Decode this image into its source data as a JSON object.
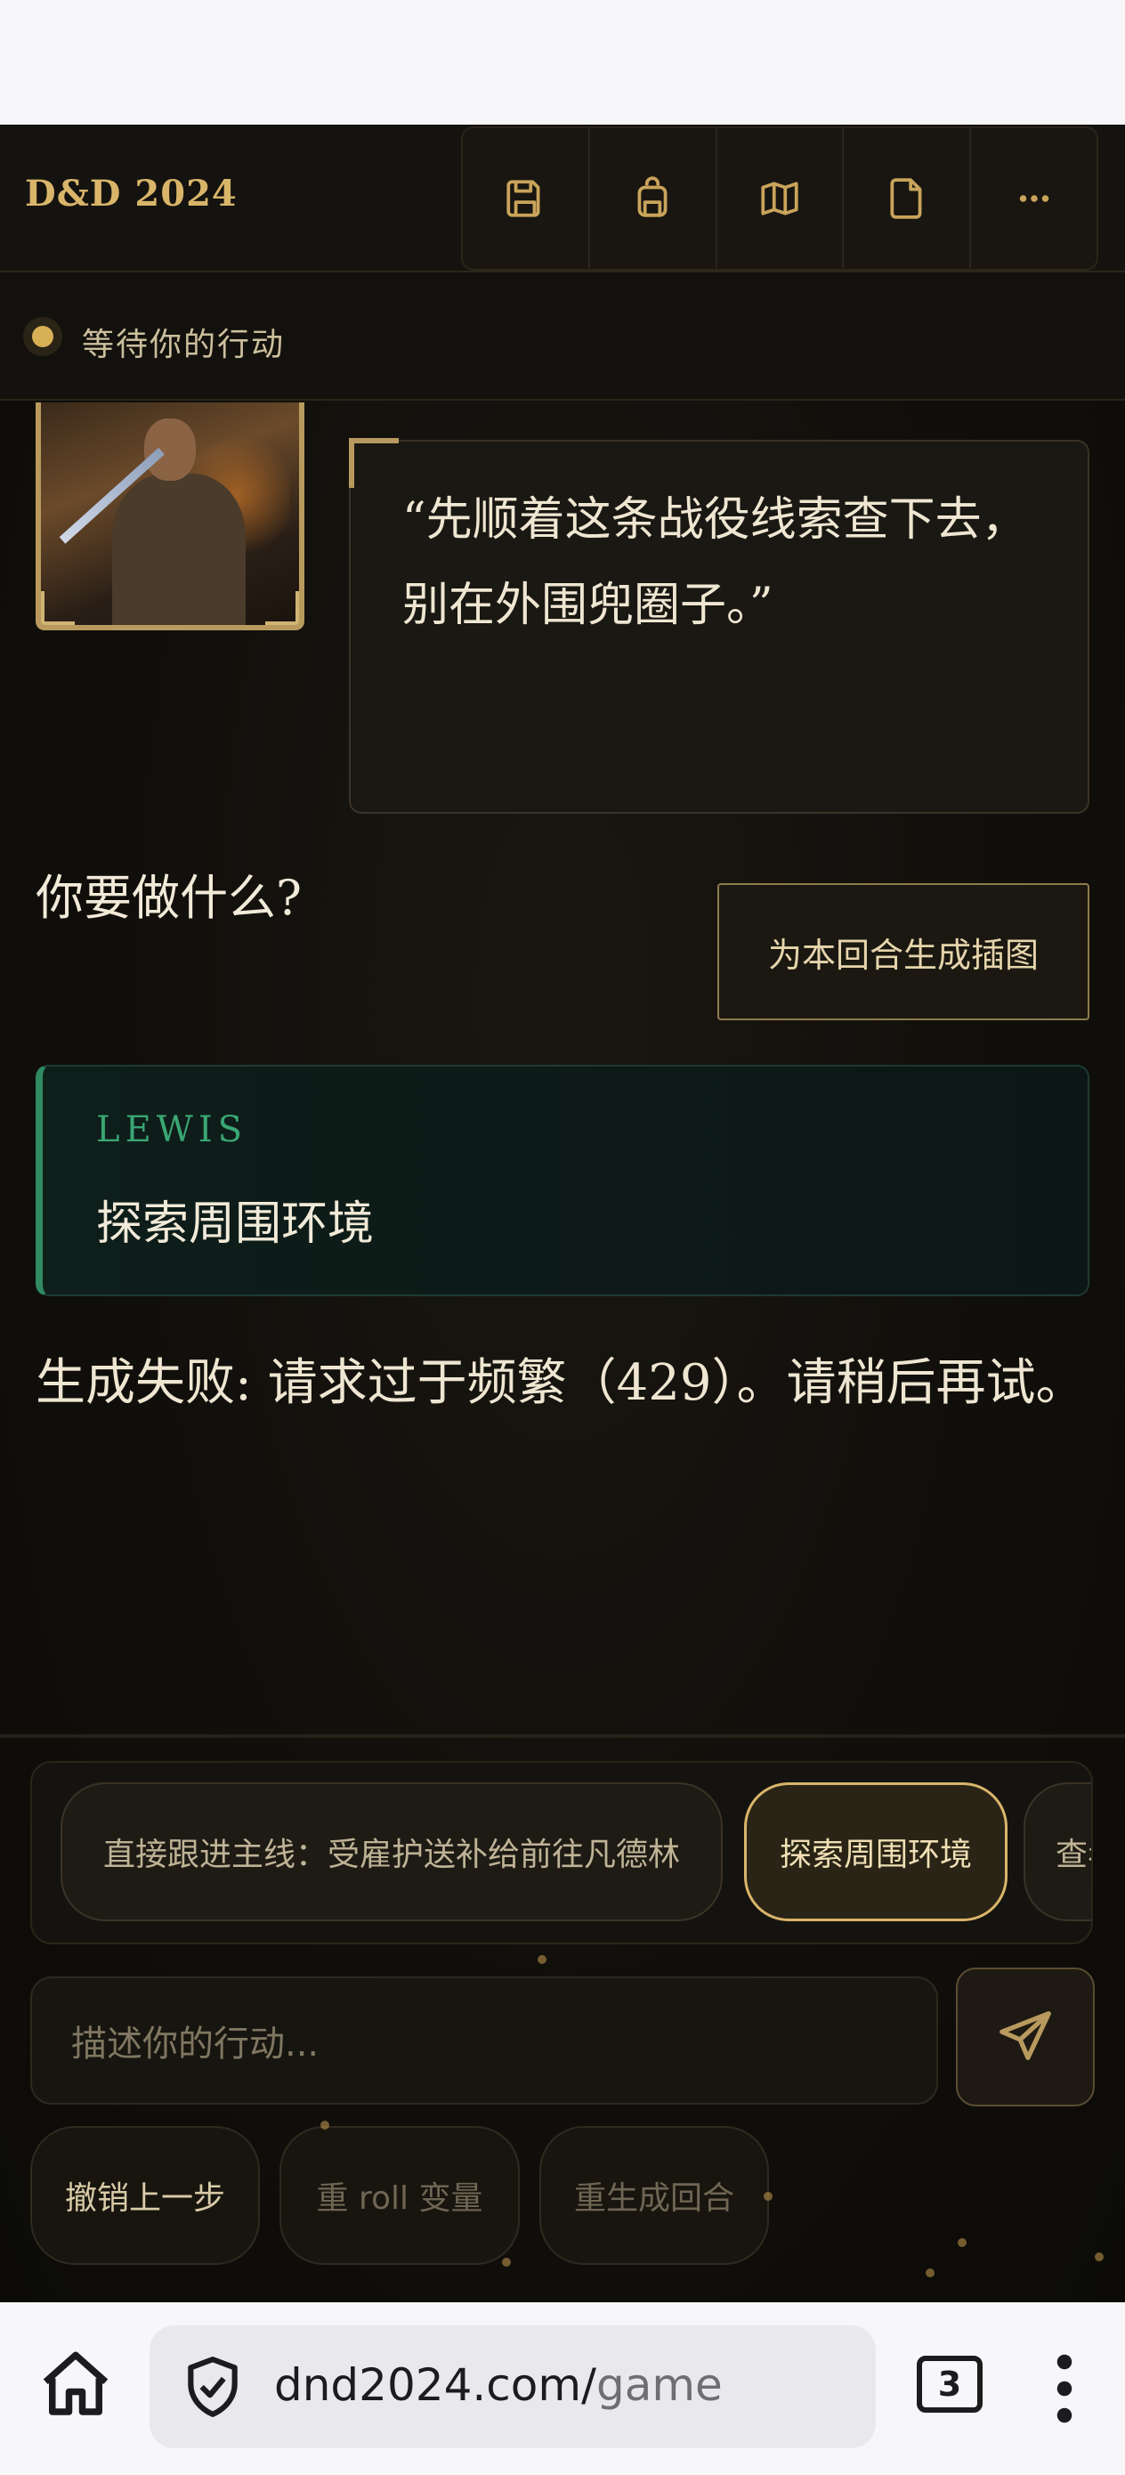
{
  "header": {
    "brand": "D&D 2024",
    "toolbar": [
      {
        "icon": "save-icon"
      },
      {
        "icon": "backpack-icon"
      },
      {
        "icon": "map-icon"
      },
      {
        "icon": "document-icon"
      },
      {
        "icon": "more-icon"
      }
    ]
  },
  "status": {
    "text": "等待你的行动"
  },
  "chat": {
    "npc_quote": "“先顺着这条战役线索查下去，别在外围兜圈子。”",
    "prompt": "你要做什么?",
    "generate_illustration_label": "为本回合生成插图",
    "player_message": {
      "name": "LEWIS",
      "action": "探索周围环境"
    },
    "error_message": "生成失败: 请求过于频繁（429）。请稍后再试。"
  },
  "composer": {
    "suggestions": [
      "直接跟进主线：受雇护送补给前往凡德林",
      "探索周围环境",
      "查看"
    ],
    "active_suggestion_index": 1,
    "input_placeholder": "描述你的行动...",
    "actions": [
      "撤销上一步",
      "重 roll 变量",
      "重生成回合"
    ]
  },
  "browser": {
    "url_domain": "dnd2024.com/",
    "url_path": "game",
    "tab_count": "3"
  },
  "colors": {
    "accent_gold": "#d9b56a",
    "player_green": "#2f8a62",
    "background": "#110f0b"
  }
}
